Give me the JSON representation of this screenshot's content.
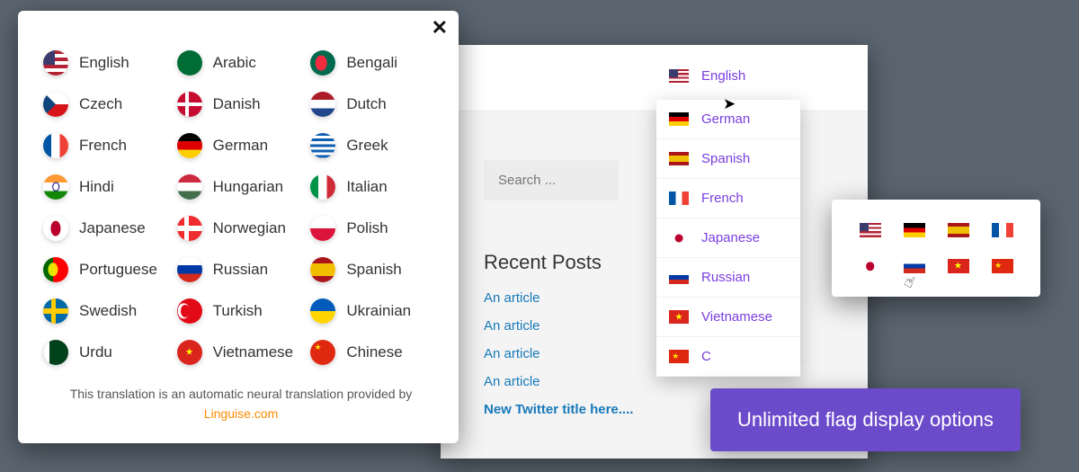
{
  "popup": {
    "close": "✕",
    "languages": [
      {
        "label": "English",
        "flag": "f-us"
      },
      {
        "label": "Arabic",
        "flag": "f-sa"
      },
      {
        "label": "Bengali",
        "flag": "f-bd"
      },
      {
        "label": "Czech",
        "flag": "f-cz"
      },
      {
        "label": "Danish",
        "flag": "f-dk"
      },
      {
        "label": "Dutch",
        "flag": "f-nl"
      },
      {
        "label": "French",
        "flag": "f-fr"
      },
      {
        "label": "German",
        "flag": "f-de"
      },
      {
        "label": "Greek",
        "flag": "f-gr"
      },
      {
        "label": "Hindi",
        "flag": "f-in"
      },
      {
        "label": "Hungarian",
        "flag": "f-hu"
      },
      {
        "label": "Italian",
        "flag": "f-it"
      },
      {
        "label": "Japanese",
        "flag": "f-jp"
      },
      {
        "label": "Norwegian",
        "flag": "f-no"
      },
      {
        "label": "Polish",
        "flag": "f-pl"
      },
      {
        "label": "Portuguese",
        "flag": "f-pt"
      },
      {
        "label": "Russian",
        "flag": "f-ru"
      },
      {
        "label": "Spanish",
        "flag": "f-es"
      },
      {
        "label": "Swedish",
        "flag": "f-se"
      },
      {
        "label": "Turkish",
        "flag": "f-tr"
      },
      {
        "label": "Ukrainian",
        "flag": "f-ua"
      },
      {
        "label": "Urdu",
        "flag": "f-pk"
      },
      {
        "label": "Vietnamese",
        "flag": "f-vn"
      },
      {
        "label": "Chinese",
        "flag": "f-cn"
      }
    ],
    "footer_text": "This translation is an automatic neural translation provided by",
    "footer_link": "Linguise.com"
  },
  "browser": {
    "search_placeholder": "Search ...",
    "recent_title": "Recent Posts",
    "posts": [
      {
        "label": "An article",
        "bold": false
      },
      {
        "label": "An article",
        "bold": false
      },
      {
        "label": "An article",
        "bold": false
      },
      {
        "label": "An article",
        "bold": false
      },
      {
        "label": "New Twitter title here....",
        "bold": true
      }
    ]
  },
  "dropdown": {
    "selected": {
      "label": "English",
      "flag": "f-us"
    },
    "items": [
      {
        "label": "German",
        "flag": "f-de"
      },
      {
        "label": "Spanish",
        "flag": "f-es"
      },
      {
        "label": "French",
        "flag": "f-fr"
      },
      {
        "label": "Japanese",
        "flag": "f-jp"
      },
      {
        "label": "Russian",
        "flag": "f-ru"
      },
      {
        "label": "Vietnamese",
        "flag": "f-vn"
      },
      {
        "label": "C",
        "flag": "f-cn"
      }
    ]
  },
  "flags_card": [
    "f-us",
    "f-de",
    "f-es",
    "f-fr",
    "f-jp",
    "f-ru",
    "f-vn",
    "f-cn"
  ],
  "banner": "Unlimited flag display options"
}
